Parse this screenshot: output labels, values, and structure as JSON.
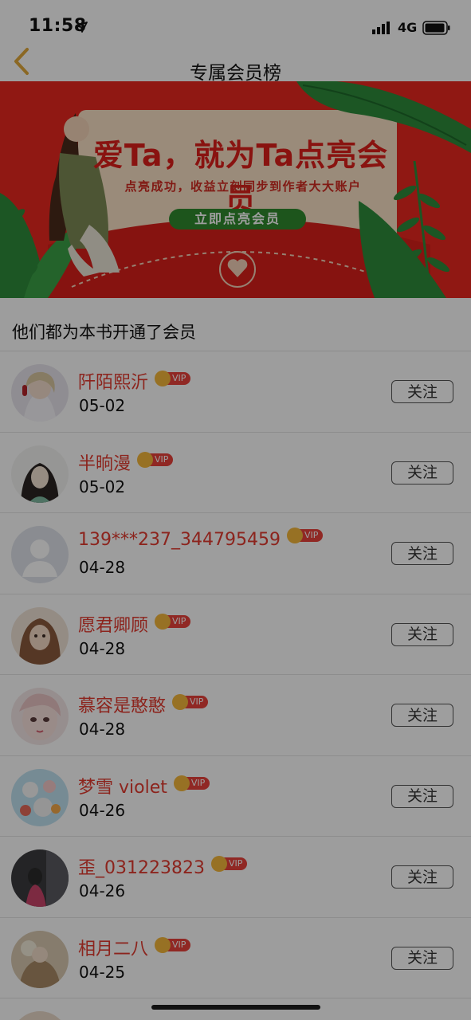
{
  "status_bar": {
    "time": "11:58",
    "network": "4G"
  },
  "nav": {
    "title": "专属会员榜"
  },
  "banner": {
    "headline": "爱Ta，就为Ta点亮会员",
    "subline": "点亮成功，收益立刻同步到作者大大账户",
    "cta": "立即点亮会员"
  },
  "section": {
    "title": "他们都为本书开通了会员"
  },
  "vip_label": "VIP",
  "follow_label": "关注",
  "members": [
    {
      "name": "阡陌熙沂",
      "date": "05-02"
    },
    {
      "name": "半晌漫",
      "date": "05-02"
    },
    {
      "name": "139***237_344795459",
      "date": "04-28"
    },
    {
      "name": "愿君卿顾",
      "date": "04-28"
    },
    {
      "name": "慕容是憨憨",
      "date": "04-28"
    },
    {
      "name": "梦雪 violet",
      "date": "04-26"
    },
    {
      "name": "歪_031223823",
      "date": "04-26"
    },
    {
      "name": "相月二八",
      "date": "04-25"
    }
  ],
  "colors": {
    "name": "#e23a2f",
    "banner_bg": "#e8271f",
    "cta_green": "#2f8a2e",
    "vip_gold": "#f4b63b"
  }
}
